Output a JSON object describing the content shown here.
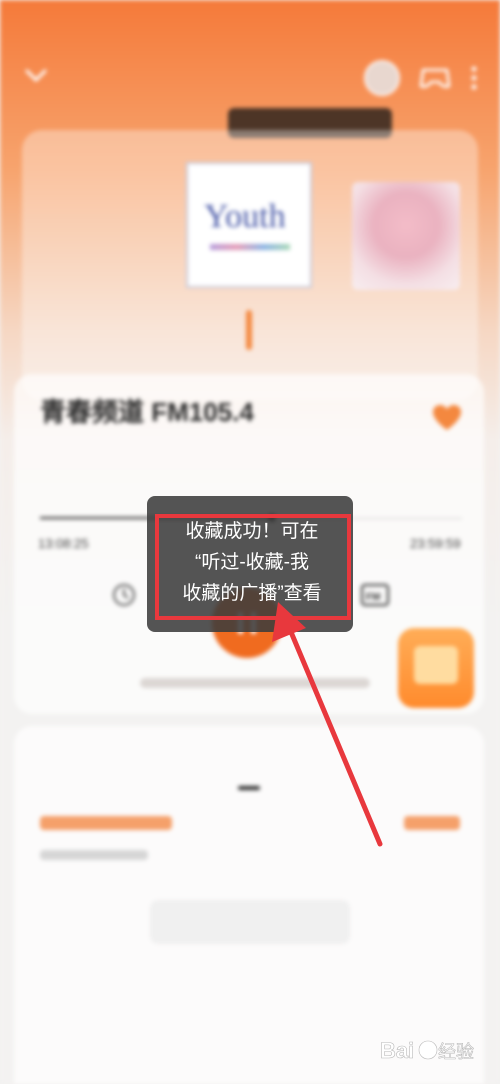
{
  "toast": {
    "line1": "收藏成功！可在",
    "line2": "“听过-收藏-我",
    "line3": "收藏的广播”查看"
  },
  "player": {
    "station": "青春频道 FM105.4",
    "time_start": "13:08:25",
    "time_end": "23:59:59",
    "progress": 0.55
  },
  "icons": {
    "collapse": "chevron-down-icon",
    "avatar": "avatar-icon",
    "gamepad": "gamepad-icon",
    "more": "more-vertical-icon",
    "favorite": "heart-icon",
    "timer": "clock-icon",
    "fm": "fm-radio-icon",
    "pause": "pause-icon"
  },
  "colors": {
    "accent": "#f06b1f",
    "highlight": "#e8383d",
    "heart": "#f4883f"
  }
}
